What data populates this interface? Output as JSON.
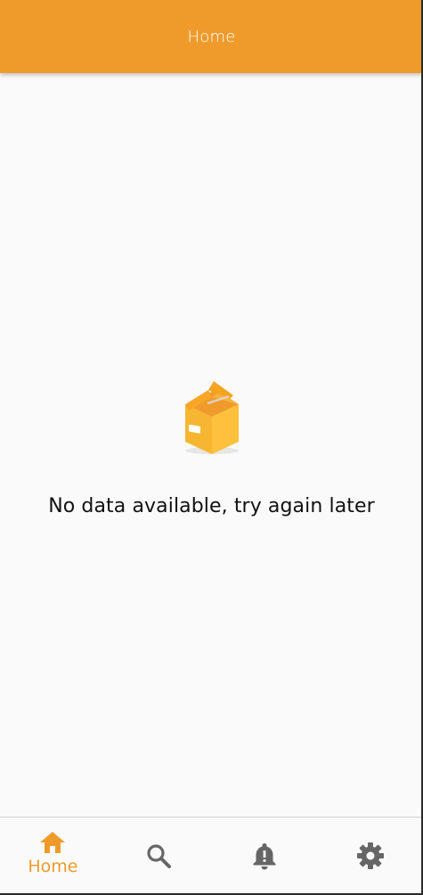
{
  "app_bar": {
    "title": "Home"
  },
  "empty_state": {
    "icon": "empty-box-icon",
    "message": "No data available, try again later"
  },
  "bottom_nav": {
    "items": [
      {
        "label": "Home",
        "icon": "home-icon",
        "active": true
      },
      {
        "label": "",
        "icon": "search-icon",
        "active": false
      },
      {
        "label": "",
        "icon": "bell-alert-icon",
        "active": false
      },
      {
        "label": "",
        "icon": "gear-icon",
        "active": false
      }
    ]
  },
  "colors": {
    "primary": "#ef9b2b",
    "inactive_icon": "#666666",
    "background": "#fafafa",
    "text": "#111111"
  }
}
